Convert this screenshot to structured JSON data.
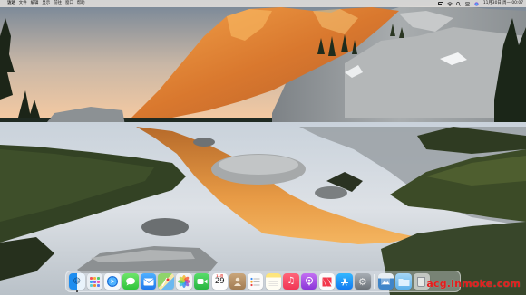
{
  "menubar": {
    "apple_symbol": "",
    "items": [
      "访达",
      "文件",
      "编辑",
      "显示",
      "前往",
      "窗口",
      "帮助"
    ],
    "clock": "11月30日 周一 00:07"
  },
  "dock": {
    "apps": [
      {
        "name": "Finder",
        "icon": "finder-icon"
      },
      {
        "name": "Launchpad",
        "icon": "launchpad-icon"
      },
      {
        "name": "Safari",
        "icon": "safari-icon"
      },
      {
        "name": "Messages",
        "icon": "messages-icon"
      },
      {
        "name": "Mail",
        "icon": "mail-icon"
      },
      {
        "name": "Maps",
        "icon": "maps-icon"
      },
      {
        "name": "Photos",
        "icon": "photos-icon"
      },
      {
        "name": "FaceTime",
        "icon": "facetime-icon"
      },
      {
        "name": "Calendar",
        "icon": "calendar-icon"
      },
      {
        "name": "Contacts",
        "icon": "contacts-icon"
      },
      {
        "name": "Reminders",
        "icon": "reminders-icon"
      },
      {
        "name": "Notes",
        "icon": "notes-icon"
      },
      {
        "name": "Music",
        "icon": "music-icon"
      },
      {
        "name": "Podcasts",
        "icon": "podcasts-icon"
      },
      {
        "name": "News",
        "icon": "news-icon"
      },
      {
        "name": "App Store",
        "icon": "app-store-icon"
      },
      {
        "name": "System Preferences",
        "icon": "settings-icon"
      },
      {
        "name": "Preview",
        "icon": "preview-icon"
      },
      {
        "name": "Downloads",
        "icon": "folder-icon"
      },
      {
        "name": "Trash",
        "icon": "trash-icon"
      }
    ],
    "calendar_month": "11月",
    "calendar_day": "29"
  },
  "watermark": "acg.inmoke.com",
  "colors": {
    "sky_top": "#7f8fa0",
    "sky_bottom": "#f2c7a0",
    "cliff_lit": "#e08a3a",
    "grass": "#2f3d24",
    "water": "#d9dde2",
    "watermark": "#e61c1c"
  }
}
